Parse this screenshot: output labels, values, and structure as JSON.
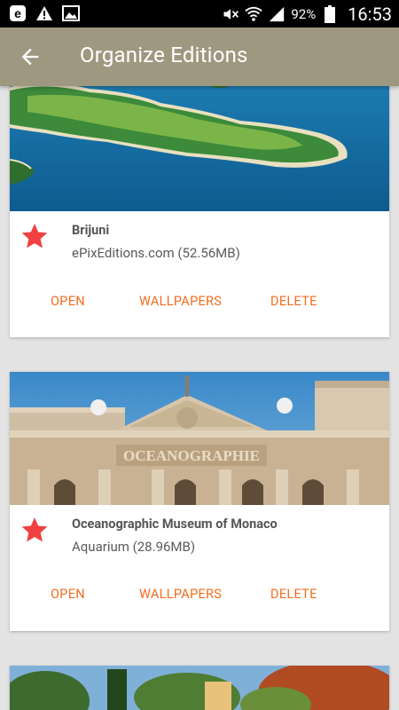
{
  "status_bar": {
    "battery_text": "92%",
    "time": "16:53",
    "icons": [
      "edge-browser-icon",
      "warning-icon",
      "image-icon",
      "mute-icon",
      "wifi-icon",
      "signal-icon",
      "battery-icon"
    ]
  },
  "app_bar": {
    "title": "Organize Editions",
    "back_icon": "arrow-back-icon"
  },
  "colors": {
    "app_bar": "#9e9880",
    "accent": "#f26b1d",
    "star": "#f04040",
    "background": "#e3e3e3"
  },
  "editions": [
    {
      "title": "Brijuni",
      "subtitle": "ePixEditions.com (52.56MB)",
      "favorite": true,
      "actions": {
        "open": "OPEN",
        "wallpapers": "WALLPAPERS",
        "delete": "DELETE"
      }
    },
    {
      "title": "Oceanographic Museum of Monaco",
      "subtitle": "Aquarium (28.96MB)",
      "favorite": true,
      "actions": {
        "open": "OPEN",
        "wallpapers": "WALLPAPERS",
        "delete": "DELETE"
      }
    }
  ],
  "building_inscription": "OCEANOGRAPHIE"
}
